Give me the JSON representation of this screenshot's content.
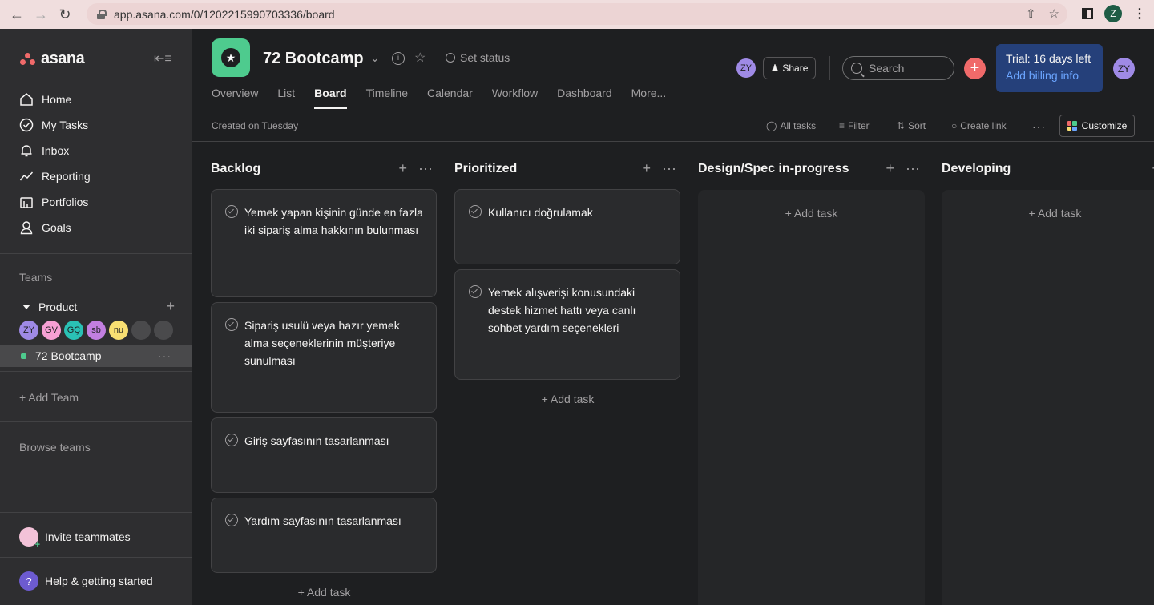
{
  "browser": {
    "url": "app.asana.com/0/1202215990703336/board",
    "profile_initial": "Z"
  },
  "sidebar": {
    "logo_text": "asana",
    "nav": [
      {
        "label": "Home",
        "icon": "home-icon"
      },
      {
        "label": "My Tasks",
        "icon": "check-circle-icon"
      },
      {
        "label": "Inbox",
        "icon": "bell-icon"
      },
      {
        "label": "Reporting",
        "icon": "chart-line-icon"
      },
      {
        "label": "Portfolios",
        "icon": "portfolio-icon"
      },
      {
        "label": "Goals",
        "icon": "person-icon"
      }
    ],
    "teams_label": "Teams",
    "team_name": "Product",
    "members": [
      {
        "initials": "ZY",
        "color": "#9f8ae6"
      },
      {
        "initials": "GV",
        "color": "#f6a0d4"
      },
      {
        "initials": "GÇ",
        "color": "#2ac1b5"
      },
      {
        "initials": "sb",
        "color": "#c27fe0"
      },
      {
        "initials": "nu",
        "color": "#f8df72"
      },
      {
        "initials": "",
        "color": "#4a4a4c"
      },
      {
        "initials": "",
        "color": "#4a4a4c"
      }
    ],
    "project_name": "72 Bootcamp",
    "add_team": "+ Add Team",
    "browse_teams": "Browse teams",
    "invite": "Invite teammates",
    "help": "Help & getting started"
  },
  "header": {
    "project_title": "72 Bootcamp",
    "set_status": "Set status",
    "tabs": [
      "Overview",
      "List",
      "Board",
      "Timeline",
      "Calendar",
      "Workflow",
      "Dashboard",
      "More..."
    ],
    "active_tab": "Board",
    "avatar_initials": "ZY",
    "share": "Share",
    "search_placeholder": "Search",
    "trial_line1": "Trial: 16 days left",
    "trial_line2": "Add billing info",
    "user_initials": "ZY"
  },
  "toolbar": {
    "created": "Created on Tuesday",
    "all_tasks": "All tasks",
    "filter": "Filter",
    "sort": "Sort",
    "create_link": "Create link",
    "customize": "Customize"
  },
  "board": {
    "add_task_label": "+ Add task",
    "columns": [
      {
        "title": "Backlog",
        "tasks": [
          "Yemek yapan kişinin günde en fazla iki sipariş alma hakkının bulunması",
          "Sipariş usulü veya hazır yemek alma seçeneklerinin müşteriye sunulması",
          "Giriş sayfasının tasarlanması",
          "Yardım sayfasının tasarlanması"
        ]
      },
      {
        "title": "Prioritized",
        "tasks": [
          "Kullanıcı doğrulamak",
          "Yemek alışverişi konusundaki destek hizmet hattı veya canlı sohbet yardım seçenekleri"
        ]
      },
      {
        "title": "Design/Spec in-progress",
        "tasks": []
      },
      {
        "title": "Developing",
        "tasks": []
      }
    ]
  }
}
